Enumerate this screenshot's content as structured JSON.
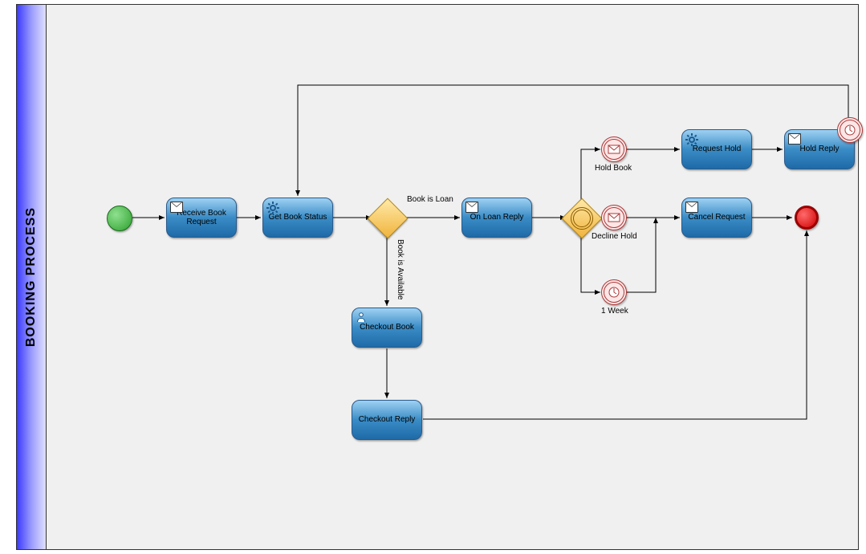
{
  "lane": {
    "title": "BOOKING PROCESS"
  },
  "events": {
    "start": "Start",
    "end": "End",
    "holdBook": "Hold Book",
    "declineHold": "Decline Hold",
    "oneWeek": "1 Week"
  },
  "tasks": {
    "receiveBookRequest": "Receive Book Request",
    "getBookStatus": "Get Book Status",
    "onLoanReply": "On Loan Reply",
    "checkoutBook": "Checkout Book",
    "checkoutReply": "Checkout Reply",
    "requestHold": "Request Hold",
    "holdReply": "Hold Reply",
    "cancelRequest": "Cancel Request"
  },
  "gateways": {
    "bookStatus": "Book status gateway",
    "holdDecision": "Hold decision event gateway"
  },
  "edgeLabels": {
    "bookIsLoan": "Book is Loan",
    "bookIsAvailable": "Book is Available"
  }
}
